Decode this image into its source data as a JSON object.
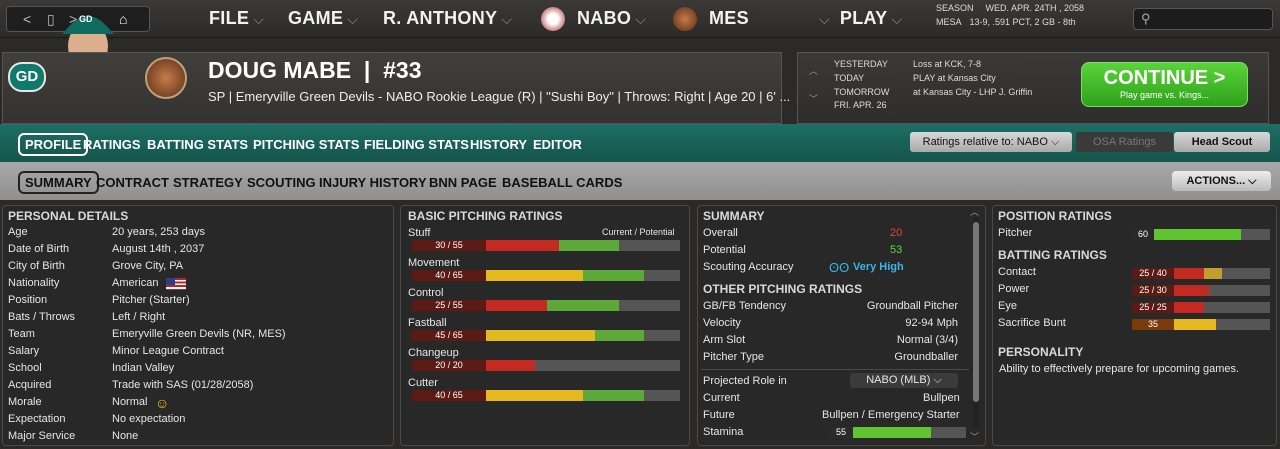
{
  "topnav": {
    "items": [
      "FILE",
      "GAME",
      "R. ANTHONY",
      "NABO",
      "MES",
      "PLAY"
    ],
    "season_label": "SEASON",
    "date": "WED. APR. 24TH , 2058",
    "team_abbr": "MESA",
    "record": "13-9, .591 PCT, 2 GB - 8th"
  },
  "player": {
    "logo_text": "GD",
    "name": "DOUG MABE",
    "number": "#33",
    "subtitle": "SP | Emeryville Green Devils - NABO Rookie League (R)  |  \"Sushi Boy\" | Throws: Right  |  Age 20  |  6' ..."
  },
  "schedule": {
    "rows": [
      {
        "label": "YESTERDAY",
        "value": "Loss at KCK, 7-8"
      },
      {
        "label": "TODAY",
        "value": "PLAY at Kansas City"
      },
      {
        "label": "TOMORROW",
        "value": "at Kansas City - LHP J. Griffin"
      },
      {
        "label": "FRI. APR. 26",
        "value": ""
      }
    ],
    "continue_label": "CONTINUE >",
    "continue_sub": "Play game vs. Kings..."
  },
  "tabs": [
    "PROFILE",
    "RATINGS",
    "BATTING STATS",
    "PITCHING STATS",
    "FIELDING STATS",
    "HISTORY",
    "EDITOR"
  ],
  "ratings_relative": "Ratings relative to: NABO",
  "osa_ratings": "OSA Ratings",
  "head_scout": "Head Scout",
  "subtabs": [
    "SUMMARY",
    "CONTRACT",
    "STRATEGY",
    "SCOUTING",
    "INJURY HISTORY",
    "BNN PAGE",
    "BASEBALL CARDS"
  ],
  "actions_label": "ACTIONS...",
  "personal": {
    "title": "PERSONAL DETAILS",
    "rows": [
      {
        "label": "Age",
        "value": "20 years, 253 days"
      },
      {
        "label": "Date of Birth",
        "value": "August 14th , 2037"
      },
      {
        "label": "City of Birth",
        "value": "Grove City, PA"
      },
      {
        "label": "Nationality",
        "value": "American"
      },
      {
        "label": "Position",
        "value": "Pitcher (Starter)"
      },
      {
        "label": "Bats / Throws",
        "value": "Left / Right"
      },
      {
        "label": "Team",
        "value": "Emeryville Green Devils (NR, MES)"
      },
      {
        "label": "Salary",
        "value": "Minor League Contract"
      },
      {
        "label": "School",
        "value": "Indian Valley"
      },
      {
        "label": "Acquired",
        "value": "Trade with SAS (01/28/2058)"
      },
      {
        "label": "Morale",
        "value": "Normal"
      },
      {
        "label": "Expectation",
        "value": "No expectation"
      },
      {
        "label": "Major Service",
        "value": "None"
      }
    ]
  },
  "pitching": {
    "title": "BASIC PITCHING RATINGS",
    "col_header": "Current / Potential",
    "ratings": [
      {
        "name": "Stuff",
        "text": "30 / 55",
        "current": 30,
        "potential": 55
      },
      {
        "name": "Movement",
        "text": "40 / 65",
        "current": 40,
        "potential": 65
      },
      {
        "name": "Control",
        "text": "25 / 55",
        "current": 25,
        "potential": 55
      },
      {
        "name": "Fastball",
        "text": "45 / 65",
        "current": 45,
        "potential": 65
      },
      {
        "name": "Changeup",
        "text": "20 / 20",
        "current": 20,
        "potential": 20
      },
      {
        "name": "Cutter",
        "text": "40 / 65",
        "current": 40,
        "potential": 65
      }
    ]
  },
  "summary": {
    "title": "SUMMARY",
    "overall_label": "Overall",
    "overall": "20",
    "potential_label": "Potential",
    "potential": "53",
    "scouting_label": "Scouting Accuracy",
    "scouting": "Very High",
    "other_title": "OTHER PITCHING RATINGS",
    "other": [
      {
        "label": "GB/FB Tendency",
        "value": "Groundball Pitcher"
      },
      {
        "label": "Velocity",
        "value": "92-94 Mph"
      },
      {
        "label": "Arm Slot",
        "value": "Normal (3/4)"
      },
      {
        "label": "Pitcher Type",
        "value": "Groundballer"
      }
    ],
    "role_label": "Projected Role in",
    "role_select": "NABO (MLB)",
    "current_label": "Current",
    "current_value": "Bullpen",
    "future_label": "Future",
    "future_value": "Bullpen / Emergency Starter",
    "stamina_label": "Stamina",
    "stamina": 55
  },
  "positions": {
    "title": "POSITION RATINGS",
    "rows": [
      {
        "label": "Pitcher",
        "text": "60",
        "current": 60,
        "potential": 60
      }
    ]
  },
  "batting": {
    "title": "BATTING RATINGS",
    "rows": [
      {
        "label": "Contact",
        "text": "25 / 40",
        "current": 25,
        "potential": 40
      },
      {
        "label": "Power",
        "text": "25 / 30",
        "current": 25,
        "potential": 30
      },
      {
        "label": "Eye",
        "text": "25 / 25",
        "current": 25,
        "potential": 25
      },
      {
        "label": "Sacrifice Bunt",
        "text": "35",
        "current": 35,
        "potential": 35
      }
    ]
  },
  "personality": {
    "title": "PERSONALITY",
    "text": "Ability to effectively prepare for upcoming games."
  },
  "colors": {
    "teal": "#1e6f64",
    "green": "#5fc430",
    "red": "#c42a22",
    "yellow": "#e6b81f",
    "orange": "#ef7c1a"
  }
}
